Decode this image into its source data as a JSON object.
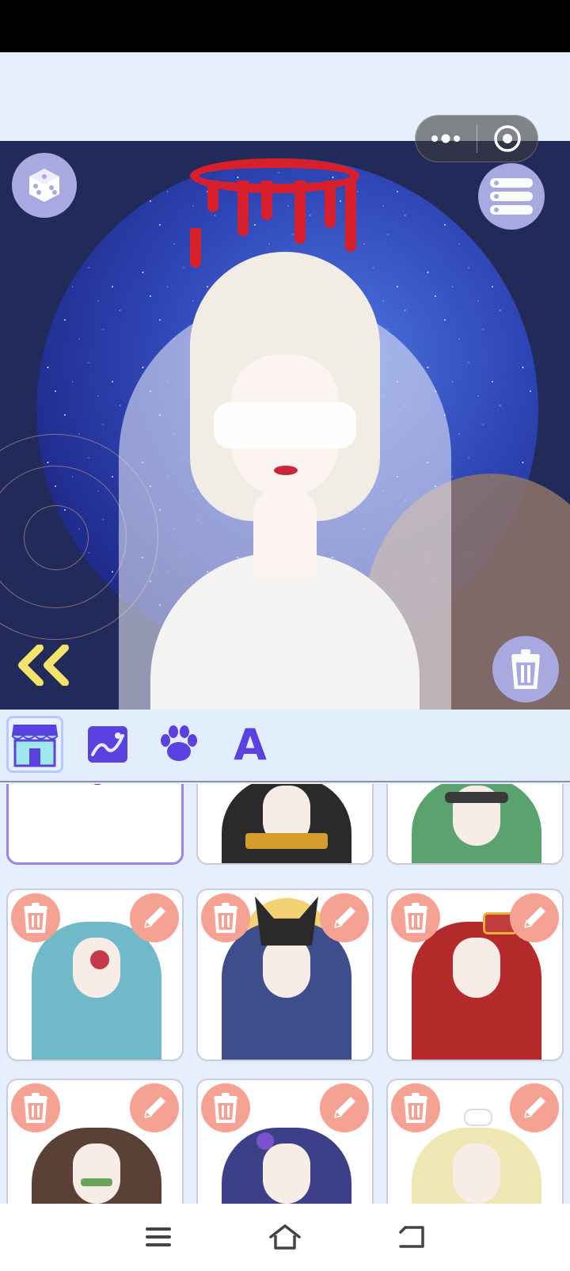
{
  "app": {
    "menu_capsule": {
      "more_icon": "more-dots-icon",
      "close_icon": "target-circle-icon"
    }
  },
  "canvas": {
    "randomize_icon": "dice-icon",
    "layers_icon": "list-icon",
    "collapse_icon": "double-chevron-left-icon",
    "delete_icon": "trash-icon"
  },
  "toolbar": {
    "tools": [
      {
        "name": "shop",
        "icon": "store-icon"
      },
      {
        "name": "background",
        "icon": "image-icon"
      },
      {
        "name": "pet",
        "icon": "paw-icon"
      },
      {
        "name": "text",
        "icon": "text-a-icon",
        "label": "A"
      }
    ]
  },
  "gallery": {
    "add_icon": "plus-icon",
    "cards": [
      {
        "id": "pharaoh",
        "hair": "#2a2a2a",
        "accent": "#d59b2c"
      },
      {
        "id": "green-hair",
        "hair": "#5aa36e",
        "accent": "#3a3a3a"
      },
      {
        "id": "blue-demon",
        "hair": "#6fb9c8",
        "accent": "#c43a4a"
      },
      {
        "id": "anubis",
        "hair": "#3e4d8c",
        "accent": "#f2d273"
      },
      {
        "id": "red-queen",
        "hair": "#b52a2a",
        "accent": "#c33c3c"
      },
      {
        "id": "bamboo-girl",
        "hair": "#5b4036",
        "accent": "#f3a5b4"
      },
      {
        "id": "violet-rose",
        "hair": "#3d3f88",
        "accent": "#7b52c9"
      },
      {
        "id": "blonde-veil",
        "hair": "#efe8b4",
        "accent": "#ffffff"
      }
    ]
  },
  "colors": {
    "accent": "#5b41e0",
    "card_button": "#f6a292",
    "canvas_button": "#a7a9e0"
  },
  "system_nav": {
    "menu_icon": "menu-icon",
    "home_icon": "home-icon",
    "back_icon": "back-icon"
  }
}
